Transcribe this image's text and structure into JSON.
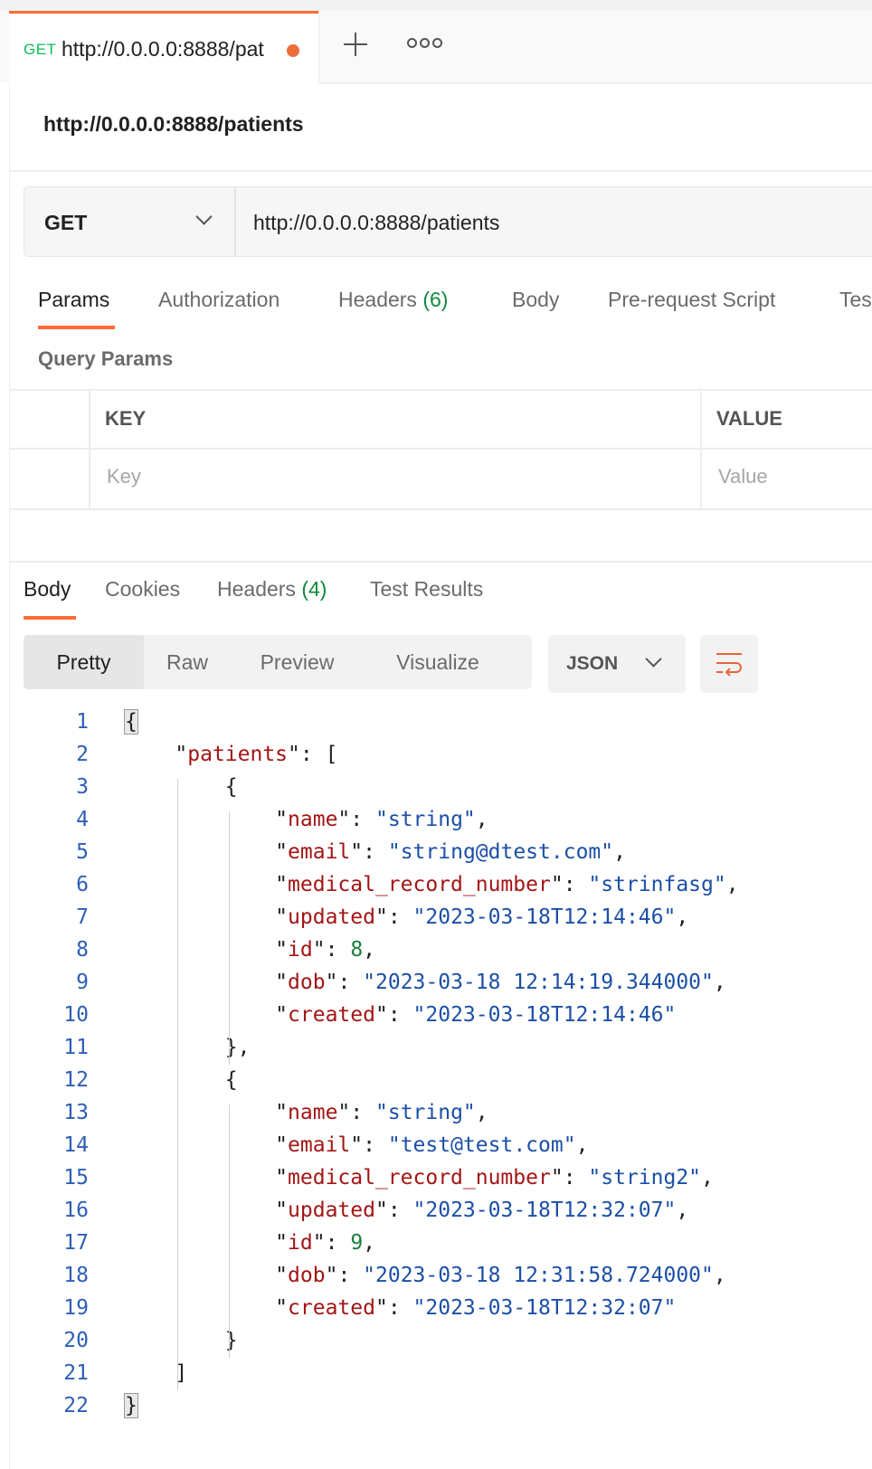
{
  "tabbar": {
    "tab_method": "GET",
    "tab_title": "http://0.0.0.0:8888/pat",
    "new_tab_icon": "plus-icon",
    "more_icon": "ellipsis-icon"
  },
  "request": {
    "name": "http://0.0.0.0:8888/patients",
    "method": "GET",
    "url": "http://0.0.0.0:8888/patients"
  },
  "request_tabs": [
    {
      "label": "Params",
      "count": ""
    },
    {
      "label": "Authorization",
      "count": ""
    },
    {
      "label": "Headers",
      "count": "(6)"
    },
    {
      "label": "Body",
      "count": ""
    },
    {
      "label": "Pre-request Script",
      "count": ""
    },
    {
      "label": "Tes",
      "count": ""
    }
  ],
  "params": {
    "title": "Query Params",
    "key_header": "KEY",
    "value_header": "VALUE",
    "key_placeholder": "Key",
    "value_placeholder": "Value"
  },
  "response_tabs": [
    {
      "label": "Body",
      "count": ""
    },
    {
      "label": "Cookies",
      "count": ""
    },
    {
      "label": "Headers",
      "count": "(4)"
    },
    {
      "label": "Test Results",
      "count": ""
    }
  ],
  "view_modes": [
    "Pretty",
    "Raw",
    "Preview",
    "Visualize"
  ],
  "format": "JSON",
  "colors": {
    "accent": "#ff6c37",
    "json_key": "#a31515",
    "json_string": "#1b4fa6",
    "json_number": "#1a7f3c",
    "line_number": "#2d5fb5"
  },
  "code_lines": [
    {
      "n": "1",
      "t": "{"
    },
    {
      "n": "2",
      "t": "    \"patients\": ["
    },
    {
      "n": "3",
      "t": "        {"
    },
    {
      "n": "4",
      "t": "            \"name\": \"string\","
    },
    {
      "n": "5",
      "t": "            \"email\": \"string@dtest.com\","
    },
    {
      "n": "6",
      "t": "            \"medical_record_number\": \"strinfasg\","
    },
    {
      "n": "7",
      "t": "            \"updated\": \"2023-03-18T12:14:46\","
    },
    {
      "n": "8",
      "t": "            \"id\": 8,"
    },
    {
      "n": "9",
      "t": "            \"dob\": \"2023-03-18 12:14:19.344000\","
    },
    {
      "n": "10",
      "t": "            \"created\": \"2023-03-18T12:14:46\""
    },
    {
      "n": "11",
      "t": "        },"
    },
    {
      "n": "12",
      "t": "        {"
    },
    {
      "n": "13",
      "t": "            \"name\": \"string\","
    },
    {
      "n": "14",
      "t": "            \"email\": \"test@test.com\","
    },
    {
      "n": "15",
      "t": "            \"medical_record_number\": \"string2\","
    },
    {
      "n": "16",
      "t": "            \"updated\": \"2023-03-18T12:32:07\","
    },
    {
      "n": "17",
      "t": "            \"id\": 9,"
    },
    {
      "n": "18",
      "t": "            \"dob\": \"2023-03-18 12:31:58.724000\","
    },
    {
      "n": "19",
      "t": "            \"created\": \"2023-03-18T12:32:07\""
    },
    {
      "n": "20",
      "t": "        }"
    },
    {
      "n": "21",
      "t": "    ]"
    },
    {
      "n": "22",
      "t": "}"
    }
  ]
}
